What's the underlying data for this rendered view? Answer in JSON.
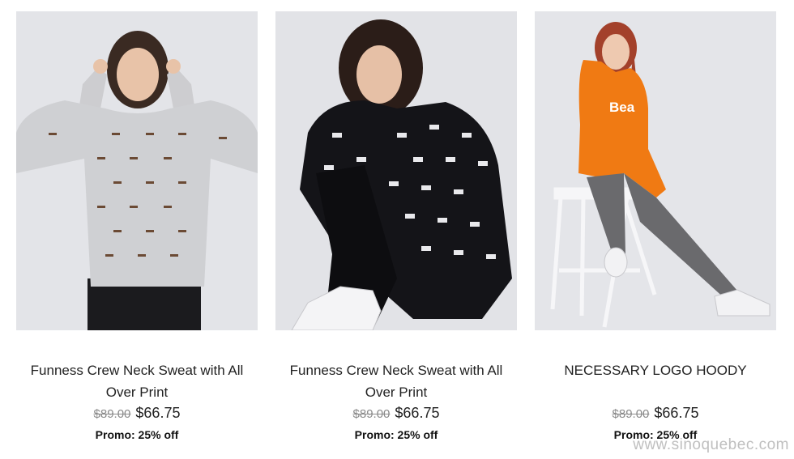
{
  "products": [
    {
      "image_alt": "model-in-grey-sweat",
      "title": "Funness Crew Neck Sweat with All Over Print",
      "old_price": "$89.00",
      "new_price": "$66.75",
      "promo": "Promo: 25% off"
    },
    {
      "image_alt": "model-in-black-sweat",
      "title": "Funness Crew Neck Sweat with All Over Print",
      "old_price": "$89.00",
      "new_price": "$66.75",
      "promo": "Promo: 25% off"
    },
    {
      "image_alt": "model-in-orange-hoody",
      "title": "NECESSARY LOGO HOODY",
      "old_price": "$89.00",
      "new_price": "$66.75",
      "promo": "Promo: 25% off"
    }
  ],
  "hoody_print": "Bea",
  "watermark": "www.sinoquebec.com",
  "colors": {
    "background": "#ffffff",
    "photo_bg": "#e1e2e6",
    "old_price": "#8a8a8a",
    "orange": "#f07a13"
  }
}
